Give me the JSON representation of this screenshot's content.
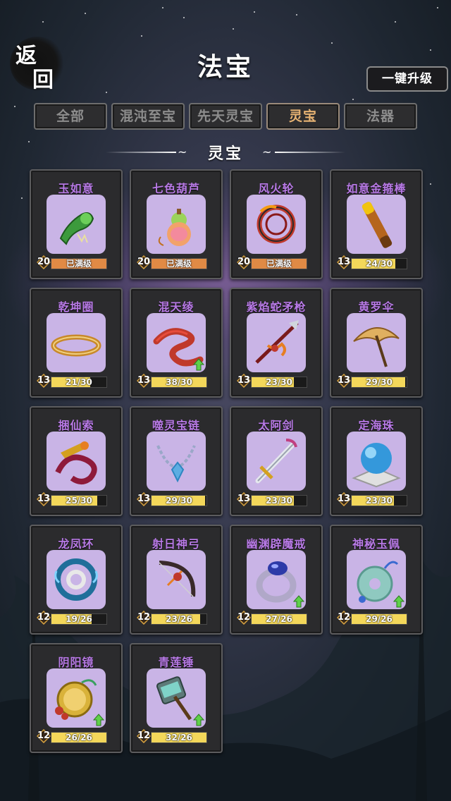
{
  "header": {
    "back_label_top": "返",
    "back_label_bottom": "回",
    "title": "法宝",
    "upgrade_all": "一键升级"
  },
  "tabs": [
    {
      "label": "全部",
      "active": false
    },
    {
      "label": "混沌至宝",
      "active": false
    },
    {
      "label": "先天灵宝",
      "active": false
    },
    {
      "label": "灵宝",
      "active": true
    },
    {
      "label": "法器",
      "active": false
    }
  ],
  "section": {
    "title": "灵宝"
  },
  "colors": {
    "accent_tab": "#e7b373",
    "item_name": "#b87ae6",
    "bar_max": "#e08a45",
    "bar_progress": "#f3d75a",
    "icon_bg": "#c9b4e6"
  },
  "items": [
    {
      "name": "玉如意",
      "level": "20",
      "progress": "已满级",
      "ratio": 1.0,
      "maxed": true,
      "upgradable": false,
      "icon": "jade-ruyi-icon"
    },
    {
      "name": "七色葫芦",
      "level": "20",
      "progress": "已满级",
      "ratio": 1.0,
      "maxed": true,
      "upgradable": false,
      "icon": "gourd-icon"
    },
    {
      "name": "风火轮",
      "level": "20",
      "progress": "已满级",
      "ratio": 1.0,
      "maxed": true,
      "upgradable": false,
      "icon": "fire-wheel-icon"
    },
    {
      "name": "如意金箍棒",
      "level": "13",
      "progress": "24/30",
      "ratio": 0.8,
      "maxed": false,
      "upgradable": false,
      "icon": "golden-staff-icon"
    },
    {
      "name": "乾坤圈",
      "level": "13",
      "progress": "21/30",
      "ratio": 0.7,
      "maxed": false,
      "upgradable": false,
      "icon": "golden-ring-icon"
    },
    {
      "name": "混天绫",
      "level": "13",
      "progress": "38/30",
      "ratio": 1.0,
      "maxed": false,
      "upgradable": true,
      "icon": "red-sash-icon"
    },
    {
      "name": "紫焰蛇矛枪",
      "level": "13",
      "progress": "23/30",
      "ratio": 0.77,
      "maxed": false,
      "upgradable": false,
      "icon": "serpent-spear-icon"
    },
    {
      "name": "黄罗伞",
      "level": "13",
      "progress": "29/30",
      "ratio": 0.97,
      "maxed": false,
      "upgradable": false,
      "icon": "umbrella-icon"
    },
    {
      "name": "捆仙索",
      "level": "13",
      "progress": "25/30",
      "ratio": 0.83,
      "maxed": false,
      "upgradable": false,
      "icon": "binding-rope-icon"
    },
    {
      "name": "噬灵宝链",
      "level": "13",
      "progress": "29/30",
      "ratio": 0.97,
      "maxed": false,
      "upgradable": false,
      "icon": "spirit-chain-icon"
    },
    {
      "name": "太阿剑",
      "level": "13",
      "progress": "23/30",
      "ratio": 0.77,
      "maxed": false,
      "upgradable": false,
      "icon": "sword-icon"
    },
    {
      "name": "定海珠",
      "level": "13",
      "progress": "23/30",
      "ratio": 0.77,
      "maxed": false,
      "upgradable": false,
      "icon": "sea-pearl-icon"
    },
    {
      "name": "龙凤环",
      "level": "12",
      "progress": "19/26",
      "ratio": 0.73,
      "maxed": false,
      "upgradable": false,
      "icon": "dragon-phoenix-ring-icon"
    },
    {
      "name": "射日神弓",
      "level": "12",
      "progress": "23/26",
      "ratio": 0.88,
      "maxed": false,
      "upgradable": false,
      "icon": "bow-icon"
    },
    {
      "name": "幽渊辟魔戒",
      "level": "12",
      "progress": "27/26",
      "ratio": 1.0,
      "maxed": false,
      "upgradable": true,
      "icon": "demon-ring-icon"
    },
    {
      "name": "神秘玉佩",
      "level": "12",
      "progress": "29/26",
      "ratio": 1.0,
      "maxed": false,
      "upgradable": true,
      "icon": "jade-pendant-icon"
    },
    {
      "name": "阴阳镜",
      "level": "12",
      "progress": "26/26",
      "ratio": 1.0,
      "maxed": false,
      "upgradable": true,
      "icon": "yin-yang-mirror-icon"
    },
    {
      "name": "青莲锤",
      "level": "12",
      "progress": "32/26",
      "ratio": 1.0,
      "maxed": false,
      "upgradable": true,
      "icon": "lotus-hammer-icon"
    }
  ]
}
